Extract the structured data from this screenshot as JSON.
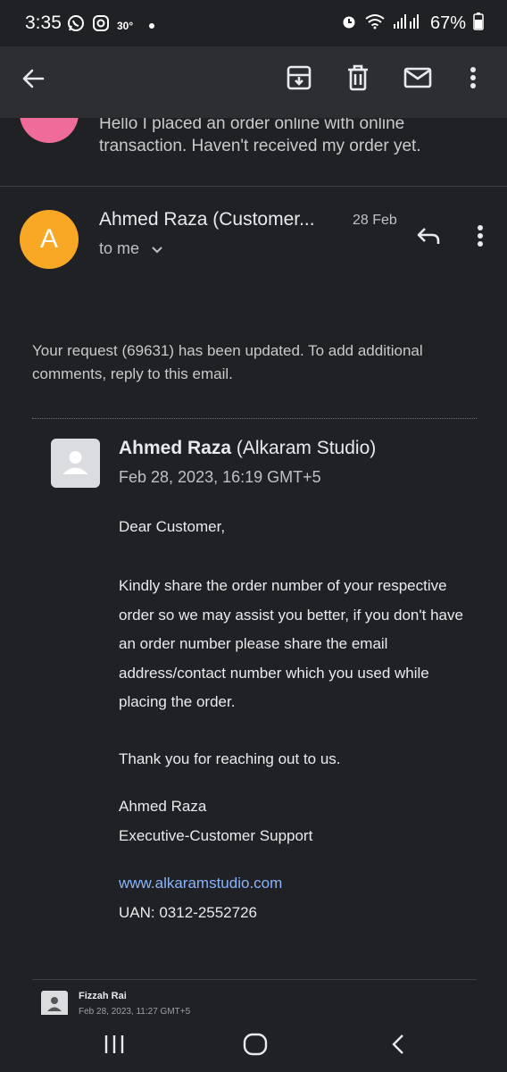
{
  "status_bar": {
    "time": "3:35",
    "temperature": "30°",
    "battery": "67%",
    "icons": [
      "whatsapp-icon",
      "instagram-icon",
      "alarm-icon",
      "wifi-icon",
      "signal-icon",
      "battery-icon"
    ]
  },
  "toolbar": {
    "icons": [
      "back-arrow-icon",
      "archive-icon",
      "trash-icon",
      "mark-unread-icon",
      "more-vert-icon"
    ]
  },
  "previous_message": {
    "snippet": "Hello I placed an order online with online transaction. Haven't received my order yet.",
    "avatar_color": "#ef6c9a"
  },
  "message": {
    "avatar_letter": "A",
    "avatar_color": "#f9a825",
    "sender": "Ahmed Raza (Customer...",
    "date": "28 Feb",
    "recipient": "to me",
    "intro": "Your request (69631) has been updated. To add additional comments, reply to this email.",
    "quoted": {
      "name": "Ahmed Raza",
      "org": "(Alkaram Studio)",
      "datetime": "Feb 28, 2023, 16:19 GMT+5",
      "greeting": "Dear Customer,",
      "paragraph": "Kindly share the order number of your respective order so we may assist you better, if you don't have an order number please share the email address/contact number which you used while placing the order.",
      "thanks": "Thank you for reaching out to us.",
      "sign_name": "Ahmed Raza",
      "sign_title": "Executive-Customer Support",
      "website": "www.alkaramstudio.com",
      "uan": "UAN: 0312-2552726"
    }
  },
  "next_message": {
    "name": "Fizzah Rai",
    "datetime": "Feb 28, 2023, 11:27 GMT+5"
  },
  "nav_bar": {
    "icons": [
      "recent-apps-icon",
      "home-icon",
      "back-icon"
    ]
  },
  "colors": {
    "background": "#202124",
    "toolbar": "#2d2e31",
    "link": "#8ab4f8"
  }
}
